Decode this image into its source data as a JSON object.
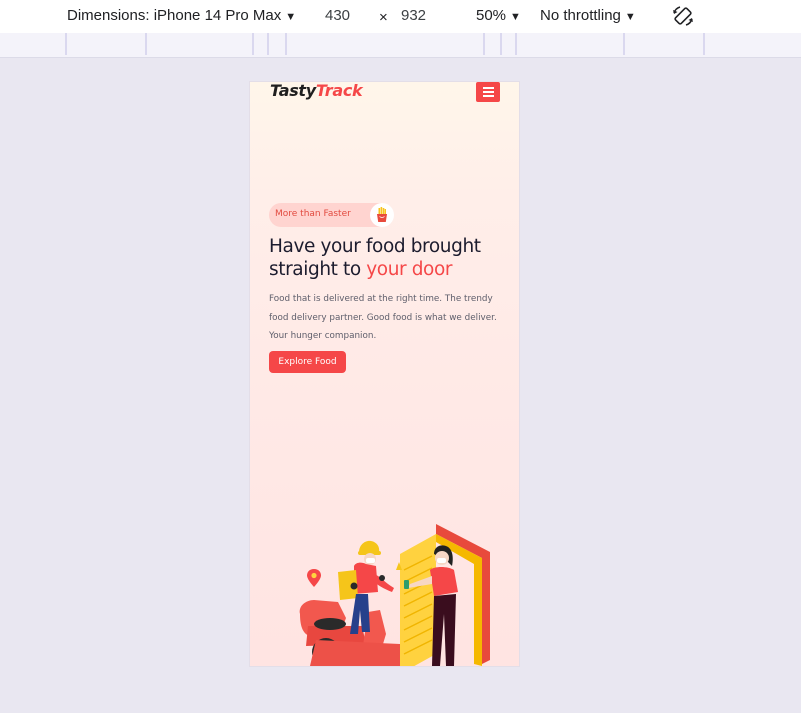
{
  "devtools": {
    "dimensions_label": "Dimensions: iPhone 14 Pro Max",
    "width": "430",
    "times": "×",
    "height": "932",
    "zoom": "50%",
    "throttling": "No throttling",
    "caret": "▼"
  },
  "site": {
    "logo_part1": "Tasty",
    "logo_part2": "Track",
    "badge_text": "More than Faster",
    "headline_part1": "Have your food brought straight to ",
    "headline_highlight": "your door",
    "description": "Food that is delivered at the right time. The trendy food delivery partner. Good food is what we deliver. Your hunger companion.",
    "cta_label": "Explore Food"
  },
  "colors": {
    "accent": "#f54748",
    "heading": "#1c1c2e",
    "page_bg": "#e9e7f1"
  }
}
